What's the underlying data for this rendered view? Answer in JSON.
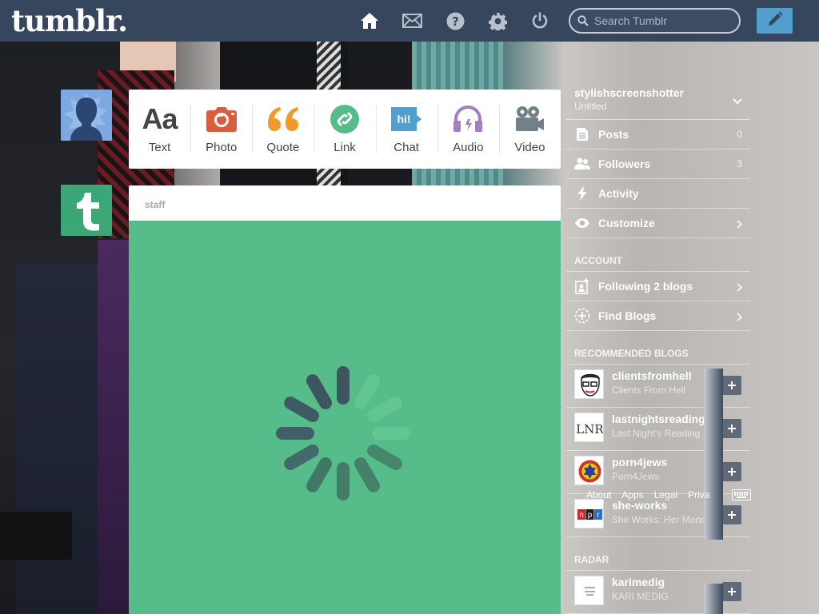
{
  "app": {
    "logo": "tumblr.",
    "search_placeholder": "Search Tumblr"
  },
  "topnav": {
    "icons": [
      "home-icon",
      "mail-icon",
      "help-icon",
      "settings-icon",
      "power-icon"
    ],
    "compose_icon": "pencil-icon"
  },
  "post_types": [
    {
      "label": "Text",
      "icon": "text-icon",
      "color": "#444444"
    },
    {
      "label": "Photo",
      "icon": "camera-icon",
      "color": "#d95e40"
    },
    {
      "label": "Quote",
      "icon": "quote-icon",
      "color": "#f2992e"
    },
    {
      "label": "Link",
      "icon": "link-icon",
      "color": "#56bc8a"
    },
    {
      "label": "Chat",
      "icon": "chat-icon",
      "color": "#529ecc"
    },
    {
      "label": "Audio",
      "icon": "headphones-icon",
      "color": "#a77dc2"
    },
    {
      "label": "Video",
      "icon": "video-camera-icon",
      "color": "#748089"
    }
  ],
  "post": {
    "author": "staff",
    "state": "loading"
  },
  "sidebar": {
    "blog_name": "stylishscreenshotter",
    "blog_title": "Untitled",
    "rows": [
      {
        "label": "Posts",
        "count": "0",
        "icon": "posts-icon"
      },
      {
        "label": "Followers",
        "count": "3",
        "icon": "followers-icon"
      },
      {
        "label": "Activity",
        "count": "",
        "icon": "activity-icon"
      },
      {
        "label": "Customize",
        "count": "",
        "icon": "eye-icon"
      }
    ],
    "account_heading": "ACCOUNT",
    "account_rows": [
      {
        "label": "Following 2 blogs",
        "icon": "following-icon"
      },
      {
        "label": "Find Blogs",
        "icon": "find-blogs-icon"
      }
    ],
    "recommended_heading": "RECOMMENDED BLOGS",
    "recommended": [
      {
        "name": "clientsfromhell",
        "title": "Clients From Hell"
      },
      {
        "name": "lastnightsreading",
        "title": "Last Night's Reading"
      },
      {
        "name": "porn4jews",
        "title": "Porn4Jews"
      },
      {
        "name": "she-works",
        "title": "She Works: Her Money"
      }
    ],
    "radar_heading": "RADAR",
    "radar": [
      {
        "name": "karimedig",
        "title": "KARI MEDIG"
      }
    ],
    "footer_links": [
      "About",
      "Apps",
      "Legal",
      "Priva"
    ]
  },
  "colors": {
    "topbar": "#36465d",
    "compose": "#529ecc",
    "post_body": "#56bd8a",
    "staff_avatar": "#3ba776"
  }
}
